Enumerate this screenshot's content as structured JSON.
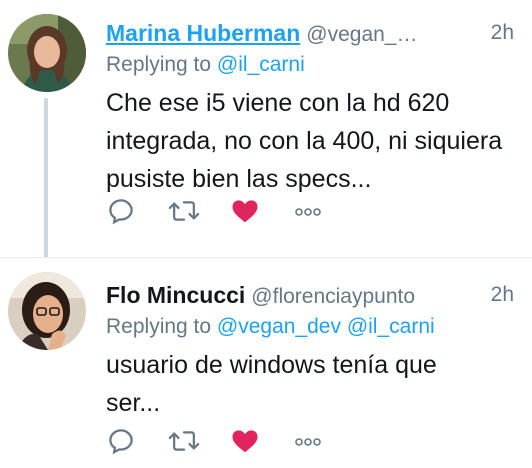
{
  "tweets": [
    {
      "name": "Marina Huberman",
      "handle": "@vegan_…",
      "time": "2h",
      "replying_label": "Replying to",
      "mentions": [
        "@il_carni"
      ],
      "text": "Che ese i5 viene con la hd 620 integrada, no con la 400, ni siquiera pusiste bien las specs...",
      "liked": true,
      "actions": [
        "reply-icon",
        "retweet-icon",
        "like-icon",
        "more-icon"
      ]
    },
    {
      "name": "Flo Mincucci",
      "handle": "@florenciaypunto",
      "time": "2h",
      "replying_label": "Replying to",
      "mentions": [
        "@vegan_dev",
        "@il_carni"
      ],
      "text": "usuario de windows tenía que ser...",
      "liked": true,
      "actions": [
        "reply-icon",
        "retweet-icon",
        "like-icon",
        "more-icon"
      ]
    }
  ],
  "colors": {
    "link": "#1da1f2",
    "secondary_text": "#657786",
    "like_active": "#e0245e",
    "thread_line": "#ccd6dd"
  }
}
